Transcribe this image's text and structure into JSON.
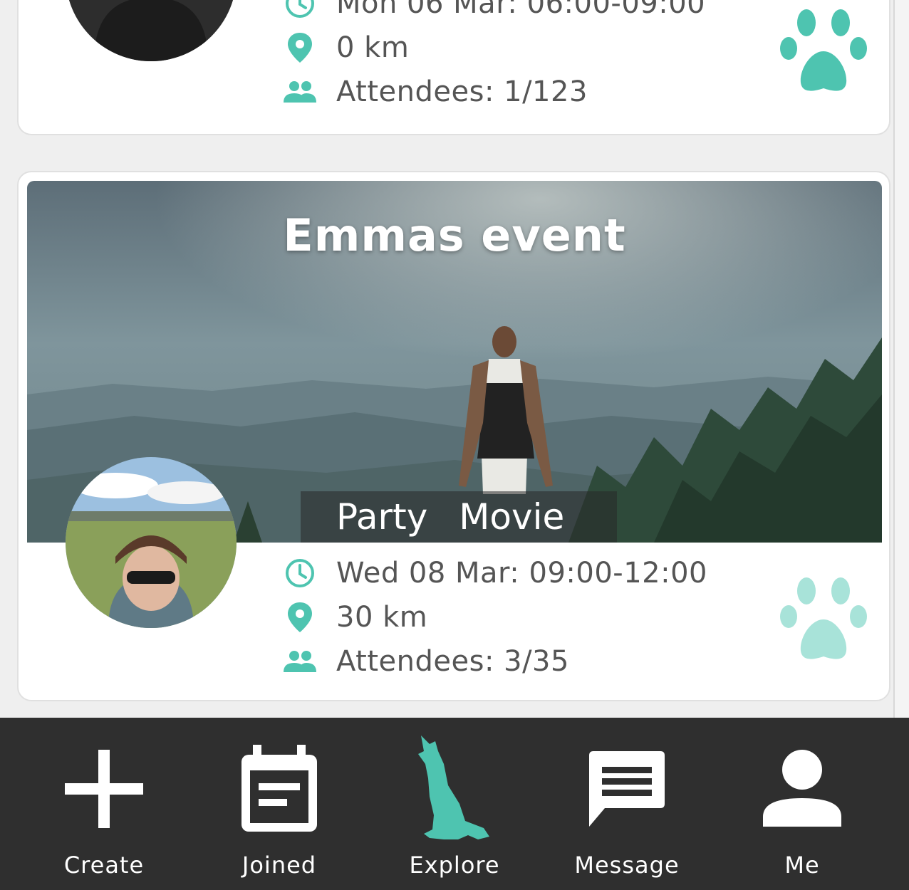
{
  "colors": {
    "accent": "#4ec4b0",
    "accent_light": "#a8e3d9",
    "navbar_bg": "#2f2f2f"
  },
  "events": [
    {
      "time": "Mon 06 Mar: 06:00-09:00",
      "distance": "0 km",
      "attendees": "Attendees: 1/123"
    },
    {
      "title": "Emmas event",
      "tags": [
        "Party",
        "Movie"
      ],
      "time": "Wed 08 Mar: 09:00-12:00",
      "distance": "30 km",
      "attendees": "Attendees: 3/35"
    }
  ],
  "icons": {
    "time": "clock-icon",
    "distance": "location-pin-icon",
    "attendees": "people-icon",
    "paw": "paw-icon"
  },
  "nav": {
    "items": [
      {
        "label": "Create",
        "icon": "plus-icon"
      },
      {
        "label": "Joined",
        "icon": "calendar-icon"
      },
      {
        "label": "Explore",
        "icon": "wolf-icon",
        "active": true
      },
      {
        "label": "Message",
        "icon": "message-icon"
      },
      {
        "label": "Me",
        "icon": "person-icon"
      }
    ]
  }
}
